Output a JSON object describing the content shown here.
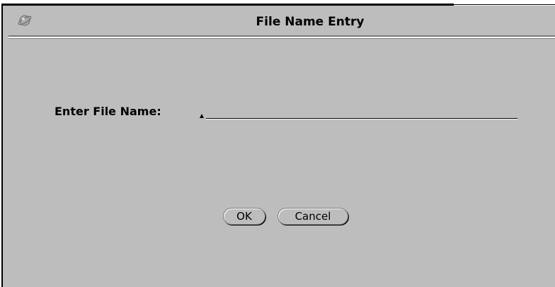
{
  "window": {
    "title": "File Name Entry",
    "menu_icon": "window-menu-icon"
  },
  "form": {
    "label": "Enter File Name:",
    "file_name_value": "",
    "file_name_placeholder": ""
  },
  "buttons": {
    "ok_label": "OK",
    "cancel_label": "Cancel"
  },
  "colors": {
    "window_background": "#bdbdbd",
    "text": "#000000",
    "bevel_dark": "#7a7a7a",
    "bevel_light": "#ffffff"
  }
}
